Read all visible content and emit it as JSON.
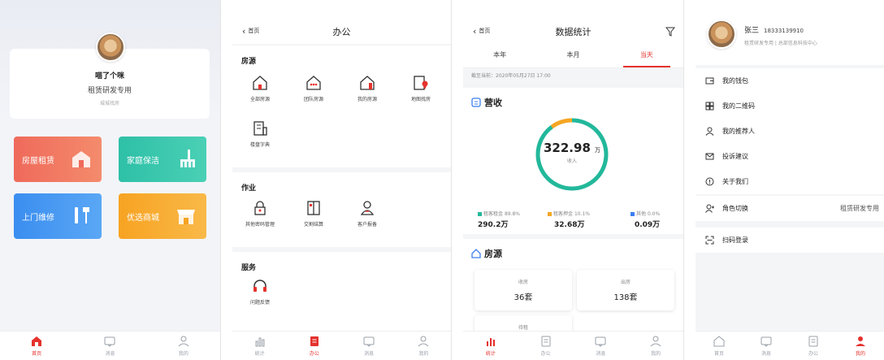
{
  "screen1": {
    "profile": {
      "name": "喵了个咪",
      "role": "租赁研发专用",
      "city": "城城找房"
    },
    "tiles": [
      {
        "label": "房屋租赁",
        "color": "#ef6a5b"
      },
      {
        "label": "家庭保洁",
        "color": "#2ec0a8"
      },
      {
        "label": "上门维修",
        "color": "#3b8ef0"
      },
      {
        "label": "优选商城",
        "color": "#f7a322"
      }
    ],
    "tabbar": [
      {
        "label": "首页",
        "icon": "home-icon",
        "active": true
      },
      {
        "label": "消息",
        "icon": "message-icon",
        "active": false
      },
      {
        "label": "我的",
        "icon": "user-icon",
        "active": false
      }
    ]
  },
  "screen2": {
    "back_label": "首页",
    "title": "办公",
    "sections": [
      {
        "heading": "房源",
        "items": [
          {
            "label": "全部房源",
            "icon": "house-icon"
          },
          {
            "label": "团队房源",
            "icon": "team-house-icon"
          },
          {
            "label": "我的房源",
            "icon": "my-house-icon"
          },
          {
            "label": "地图找房",
            "icon": "map-pin-icon"
          },
          {
            "label": "楼盘字典",
            "icon": "building-dictionary-icon"
          }
        ]
      },
      {
        "heading": "作业",
        "items": [
          {
            "label": "其他密码管理",
            "icon": "lock-icon"
          },
          {
            "label": "交割结算",
            "icon": "book-icon"
          },
          {
            "label": "客户报备",
            "icon": "customer-icon"
          }
        ]
      },
      {
        "heading": "服务",
        "items": [
          {
            "label": "问题反馈",
            "icon": "headset-icon"
          }
        ]
      }
    ],
    "tabbar": [
      {
        "label": "统计",
        "icon": "chart-icon",
        "active": false
      },
      {
        "label": "办公",
        "icon": "office-icon",
        "active": true
      },
      {
        "label": "消息",
        "icon": "message-icon",
        "active": false
      },
      {
        "label": "我的",
        "icon": "user-icon",
        "active": false
      }
    ]
  },
  "screen3": {
    "back_label": "首页",
    "title": "数据统计",
    "filter_icon": "filter-icon",
    "tabs": [
      {
        "label": "本年",
        "active": false
      },
      {
        "label": "本月",
        "active": false
      },
      {
        "label": "当天",
        "active": true
      }
    ],
    "as_of": "截至当前：2020年05月27日 17:00",
    "revenue": {
      "heading": "营收",
      "total_value": "322.98",
      "total_unit": "万",
      "total_label": "收入",
      "breakdown": [
        {
          "name": "租客租金",
          "percent": "89.8%",
          "share": 0.898,
          "value": "290.2万",
          "color": "#22b89b"
        },
        {
          "name": "租客押金",
          "percent": "10.1%",
          "share": 0.101,
          "value": "32.68万",
          "color": "#f5a623"
        },
        {
          "name": "其他",
          "percent": "0.0%",
          "share": 0.0,
          "value": "0.09万",
          "color": "#3b7ff0"
        }
      ]
    },
    "housing": {
      "heading": "房源",
      "stats": [
        {
          "label": "收房",
          "value": "36套"
        },
        {
          "label": "出房",
          "value": "138套"
        },
        {
          "label": "待租",
          "value": ""
        }
      ]
    },
    "tabbar": [
      {
        "label": "统计",
        "icon": "chart-icon",
        "active": true
      },
      {
        "label": "办公",
        "icon": "office-icon",
        "active": false
      },
      {
        "label": "消息",
        "icon": "message-icon",
        "active": false
      },
      {
        "label": "我的",
        "icon": "user-icon",
        "active": false
      }
    ]
  },
  "screen4": {
    "name": "张三",
    "phone": "18333139910",
    "org": "租赁研发专用 | 总部信息科技中心",
    "menu": [
      {
        "label": "我的钱包",
        "icon": "wallet-icon",
        "value": ""
      },
      {
        "label": "我的二维码",
        "icon": "qrcode-icon",
        "value": ""
      },
      {
        "label": "我的推荐人",
        "icon": "referrer-icon",
        "value": ""
      },
      {
        "label": "投诉建议",
        "icon": "mail-icon",
        "value": ""
      },
      {
        "label": "关于我们",
        "icon": "info-icon",
        "value": ""
      },
      {
        "label": "角色切换",
        "icon": "switch-user-icon",
        "value": "租赁研发专用"
      },
      {
        "label": "扫码登录",
        "icon": "scan-icon",
        "value": ""
      }
    ],
    "tabbar": [
      {
        "label": "首页",
        "icon": "home-icon",
        "active": false
      },
      {
        "label": "消息",
        "icon": "message-icon",
        "active": false
      },
      {
        "label": "办公",
        "icon": "office-icon",
        "active": false
      },
      {
        "label": "我的",
        "icon": "user-icon",
        "active": true
      }
    ]
  }
}
